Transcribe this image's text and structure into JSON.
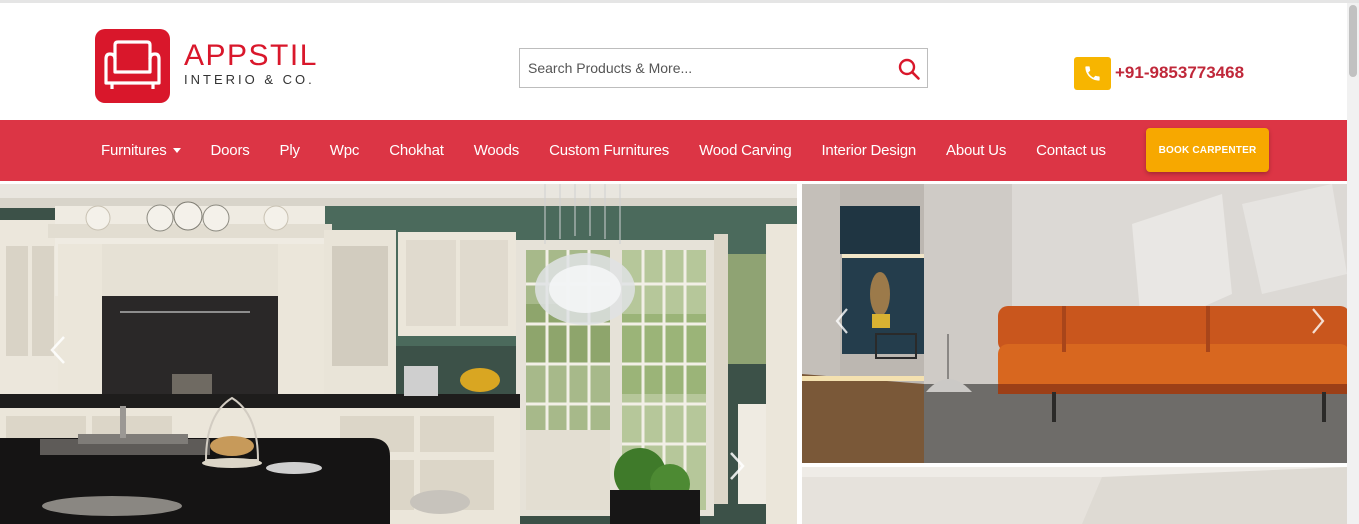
{
  "header": {
    "brand_name": "APPSTIL",
    "brand_sub": "INTERIO & CO.",
    "search_placeholder": "Search Products & More...",
    "phone": "+91-9853773468"
  },
  "nav": {
    "items": [
      {
        "label": "Furnitures",
        "dropdown": true
      },
      {
        "label": "Doors"
      },
      {
        "label": "Ply"
      },
      {
        "label": "Wpc"
      },
      {
        "label": "Chokhat"
      },
      {
        "label": "Woods"
      },
      {
        "label": "Custom Furnitures"
      },
      {
        "label": "Wood Carving"
      },
      {
        "label": "Interior Design"
      },
      {
        "label": "About Us"
      },
      {
        "label": "Contact us"
      }
    ],
    "book_button": "BOOK CARPENTER"
  },
  "colors": {
    "brand_red": "#d9172b",
    "nav_red": "#dc3545",
    "accent_orange": "#f7a800"
  },
  "icons": [
    "sofa-logo-icon",
    "search-icon",
    "phone-icon",
    "chevron-left-icon",
    "chevron-right-icon"
  ]
}
